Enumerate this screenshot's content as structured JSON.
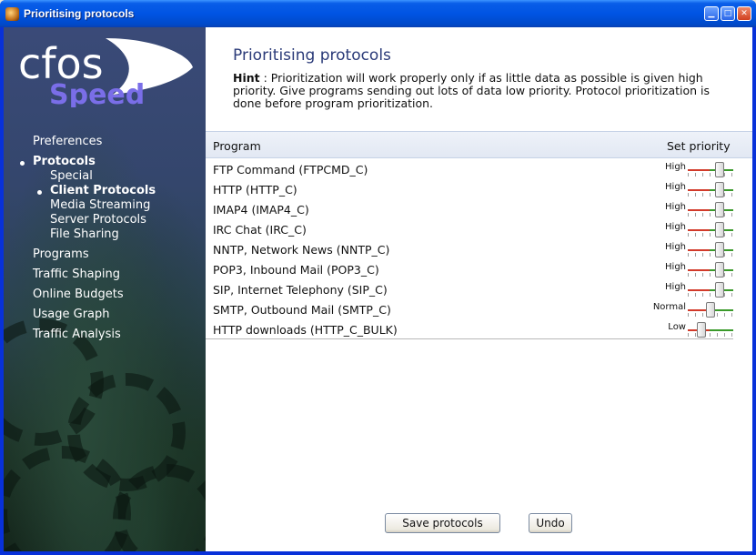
{
  "window": {
    "title": "Prioritising protocols",
    "buttons": {
      "minimize": "▁",
      "maximize": "□",
      "close": "✕"
    }
  },
  "logo": {
    "line1": "cfos",
    "line2": "Speed"
  },
  "sidebar": {
    "items": [
      {
        "label": "Preferences",
        "active": false
      },
      {
        "label": "Protocols",
        "active": true
      },
      {
        "label": "Special",
        "active": false,
        "sub": true
      },
      {
        "label": "Client Protocols",
        "active": true,
        "sub": true
      },
      {
        "label": "Media Streaming",
        "active": false,
        "sub": true
      },
      {
        "label": "Server Protocols",
        "active": false,
        "sub": true
      },
      {
        "label": "File Sharing",
        "active": false,
        "sub": true
      },
      {
        "label": "Programs",
        "active": false
      },
      {
        "label": "Traffic Shaping",
        "active": false
      },
      {
        "label": "Online Budgets",
        "active": false
      },
      {
        "label": "Usage Graph",
        "active": false
      },
      {
        "label": "Traffic Analysis",
        "active": false
      }
    ]
  },
  "main": {
    "title": "Prioritising protocols",
    "hint_label": "Hint",
    "hint_text": " : Prioritization will work properly only if as little data as possible is given high priority. Give programs sending out lots of data low priority. Protocol prioritization is done before program prioritization.",
    "columns": {
      "program": "Program",
      "priority": "Set priority"
    },
    "rows": [
      {
        "program": "FTP Command (FTPCMD_C)",
        "priority": "High",
        "level": 0.75
      },
      {
        "program": "HTTP (HTTP_C)",
        "priority": "High",
        "level": 0.75
      },
      {
        "program": "IMAP4 (IMAP4_C)",
        "priority": "High",
        "level": 0.75
      },
      {
        "program": "IRC Chat (IRC_C)",
        "priority": "High",
        "level": 0.75
      },
      {
        "program": "NNTP, Network News (NNTP_C)",
        "priority": "High",
        "level": 0.75
      },
      {
        "program": "POP3, Inbound Mail (POP3_C)",
        "priority": "High",
        "level": 0.75
      },
      {
        "program": "SIP, Internet Telephony (SIP_C)",
        "priority": "High",
        "level": 0.75
      },
      {
        "program": "SMTP, Outbound Mail (SMTP_C)",
        "priority": "Normal",
        "level": 0.5
      },
      {
        "program": "HTTP downloads (HTTP_C_BULK)",
        "priority": "Low",
        "level": 0.25
      }
    ],
    "buttons": {
      "save": "Save protocols",
      "undo": "Undo"
    }
  },
  "colors": {
    "titlebar": "#0054e3",
    "title_text": "#2a3a78",
    "logo_speed": "#7a6ee8",
    "track_high": "#d23a2a",
    "track_low": "#3a9a2a"
  }
}
